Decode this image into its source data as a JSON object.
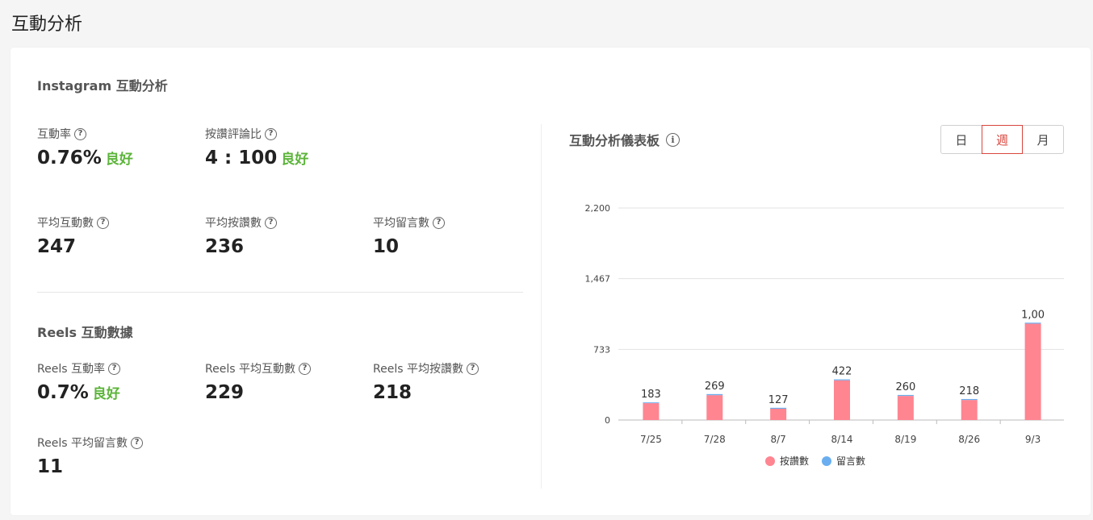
{
  "page": {
    "title": "互動分析"
  },
  "instagram": {
    "section_title": "Instagram 互動分析",
    "engagement_rate": {
      "label": "互動率",
      "value": "0.76%",
      "badge": "良好"
    },
    "like_comment_ratio": {
      "label": "按讚評論比",
      "value": "4 : 100",
      "badge": "良好"
    },
    "avg_engagement": {
      "label": "平均互動數",
      "value": "247"
    },
    "avg_likes": {
      "label": "平均按讚數",
      "value": "236"
    },
    "avg_comments": {
      "label": "平均留言數",
      "value": "10"
    }
  },
  "reels": {
    "section_title": "Reels 互動數據",
    "engagement_rate": {
      "label": "Reels 互動率",
      "value": "0.7%",
      "badge": "良好"
    },
    "avg_engagement": {
      "label": "Reels 平均互動數",
      "value": "229"
    },
    "avg_likes": {
      "label": "Reels 平均按讚數",
      "value": "218"
    },
    "avg_comments": {
      "label": "Reels 平均留言數",
      "value": "11"
    }
  },
  "help_icon_glyph": "?",
  "info_icon_glyph": "i",
  "dashboard": {
    "title": "互動分析儀表板",
    "tabs": [
      {
        "label": "日",
        "active": false
      },
      {
        "label": "週",
        "active": true
      },
      {
        "label": "月",
        "active": false
      }
    ]
  },
  "colors": {
    "likes": "#ff8591",
    "comments": "#6aaef0",
    "good": "#5cb43a",
    "active": "#d9463e"
  },
  "chart_data": {
    "type": "bar",
    "stacked": true,
    "categories": [
      "7/25",
      "7/28",
      "8/7",
      "8/14",
      "8/19",
      "8/26",
      "9/3"
    ],
    "series": [
      {
        "name": "按讚數",
        "values": [
          175,
          258,
          117,
          412,
          250,
          208,
          1000
        ]
      },
      {
        "name": "留言數",
        "values": [
          8,
          11,
          10,
          10,
          10,
          10,
          10
        ]
      }
    ],
    "totals": [
      "183",
      "269",
      "127",
      "422",
      "260",
      "218",
      "1,00"
    ],
    "yticks": [
      0,
      733,
      1467,
      2200
    ],
    "ytick_labels": [
      "0",
      "733",
      "1,467",
      "2,200"
    ],
    "ylim": [
      0,
      2200
    ],
    "grid": true,
    "legend": "bottom"
  }
}
